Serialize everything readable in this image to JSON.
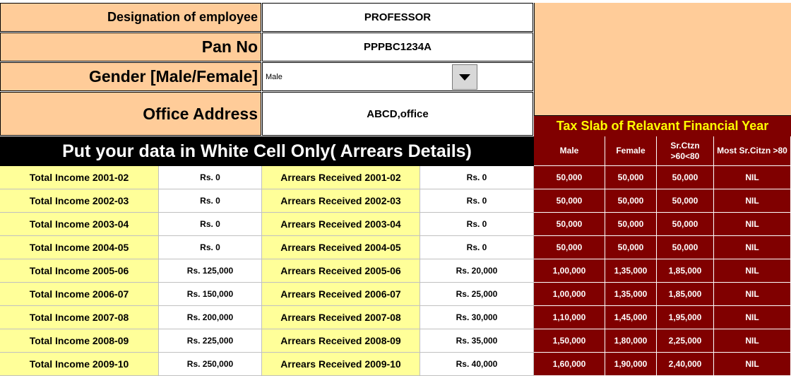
{
  "header": {
    "designation_label": "Designation of employee",
    "designation_value": "PROFESSOR",
    "pan_label": "Pan No",
    "pan_value": "PPPBC1234A",
    "gender_label": "Gender [Male/Female]",
    "gender_value": "Male",
    "address_label": "Office Address",
    "address_value": "ABCD,office"
  },
  "banner": "Put your data in White Cell Only( Arrears Details)",
  "tax_slab": {
    "title": "Tax Slab of Relavant Financial Year",
    "columns": [
      "Male",
      "Female",
      "Sr.Ctzn >60<80",
      "Most Sr.Citzn >80"
    ]
  },
  "rows": [
    {
      "income_label": "Total Income  2001-02",
      "income": "Rs. 0",
      "arrears_label": "Arrears Received 2001-02",
      "arrears": "Rs. 0",
      "male": "50,000",
      "female": "50,000",
      "sr": "50,000",
      "most_sr": "NIL"
    },
    {
      "income_label": "Total Income  2002-03",
      "income": "Rs. 0",
      "arrears_label": "Arrears Received 2002-03",
      "arrears": "Rs. 0",
      "male": "50,000",
      "female": "50,000",
      "sr": "50,000",
      "most_sr": "NIL"
    },
    {
      "income_label": "Total Income  2003-04",
      "income": "Rs. 0",
      "arrears_label": "Arrears Received 2003-04",
      "arrears": "Rs. 0",
      "male": "50,000",
      "female": "50,000",
      "sr": "50,000",
      "most_sr": "NIL"
    },
    {
      "income_label": "Total Income  2004-05",
      "income": "Rs. 0",
      "arrears_label": "Arrears Received 2004-05",
      "arrears": "Rs. 0",
      "male": "50,000",
      "female": "50,000",
      "sr": "50,000",
      "most_sr": "NIL"
    },
    {
      "income_label": "Total Income  2005-06",
      "income": "Rs. 125,000",
      "arrears_label": "Arrears Received 2005-06",
      "arrears": "Rs. 20,000",
      "male": "1,00,000",
      "female": "1,35,000",
      "sr": "1,85,000",
      "most_sr": "NIL"
    },
    {
      "income_label": "Total Income  2006-07",
      "income": "Rs. 150,000",
      "arrears_label": "Arrears Received 2006-07",
      "arrears": "Rs. 25,000",
      "male": "1,00,000",
      "female": "1,35,000",
      "sr": "1,85,000",
      "most_sr": "NIL"
    },
    {
      "income_label": "Total Income  2007-08",
      "income": "Rs. 200,000",
      "arrears_label": "Arrears Received 2007-08",
      "arrears": "Rs. 30,000",
      "male": "1,10,000",
      "female": "1,45,000",
      "sr": "1,95,000",
      "most_sr": "NIL"
    },
    {
      "income_label": "Total Income  2008-09",
      "income": "Rs. 225,000",
      "arrears_label": "Arrears Received 2008-09",
      "arrears": "Rs. 35,000",
      "male": "1,50,000",
      "female": "1,80,000",
      "sr": "2,25,000",
      "most_sr": "NIL"
    },
    {
      "income_label": "Total Income  2009-10",
      "income": "Rs. 250,000",
      "arrears_label": "Arrears Received 2009-10",
      "arrears": "Rs. 40,000",
      "male": "1,60,000",
      "female": "1,90,000",
      "sr": "2,40,000",
      "most_sr": "NIL"
    }
  ],
  "colors": {
    "peach": "#ffcc99",
    "yellow": "#ffff99",
    "maroon": "#800000",
    "tax_title_text": "#ffff00"
  }
}
